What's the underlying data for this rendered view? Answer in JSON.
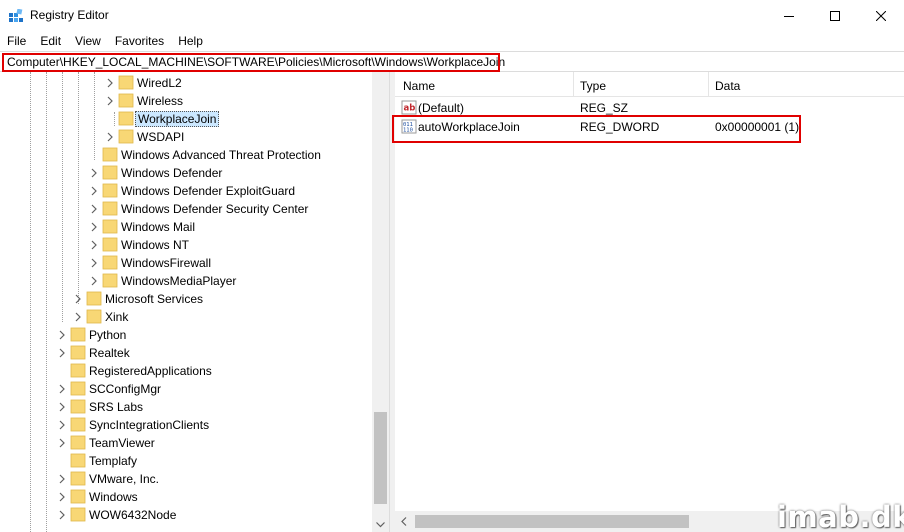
{
  "window": {
    "title": "Registry Editor",
    "minimize_icon": "minimize-icon",
    "maximize_icon": "maximize-icon",
    "close_icon": "close-icon"
  },
  "menu": [
    "File",
    "Edit",
    "View",
    "Favorites",
    "Help"
  ],
  "address": {
    "path": "Computer\\HKEY_LOCAL_MACHINE\\SOFTWARE\\Policies\\Microsoft\\Windows\\WorkplaceJoin",
    "highlight_color": "#e00000"
  },
  "tree": {
    "items": [
      {
        "label": "WiredL2",
        "expandable": true,
        "selected": false
      },
      {
        "label": "Wireless",
        "expandable": true,
        "selected": false
      },
      {
        "label": "WorkplaceJoin",
        "expandable": false,
        "selected": true
      },
      {
        "label": "WSDAPI",
        "expandable": true,
        "selected": false
      },
      {
        "label": "Windows Advanced Threat Protection",
        "expandable": false,
        "selected": false
      },
      {
        "label": "Windows Defender",
        "expandable": true,
        "selected": false
      },
      {
        "label": "Windows Defender ExploitGuard",
        "expandable": true,
        "selected": false
      },
      {
        "label": "Windows Defender Security Center",
        "expandable": true,
        "selected": false
      },
      {
        "label": "Windows Mail",
        "expandable": true,
        "selected": false
      },
      {
        "label": "Windows NT",
        "expandable": true,
        "selected": false
      },
      {
        "label": "WindowsFirewall",
        "expandable": true,
        "selected": false
      },
      {
        "label": "WindowsMediaPlayer",
        "expandable": true,
        "selected": false
      },
      {
        "label": "Microsoft Services",
        "expandable": true,
        "selected": false
      },
      {
        "label": "Xink",
        "expandable": true,
        "selected": false
      },
      {
        "label": "Python",
        "expandable": true,
        "selected": false
      },
      {
        "label": "Realtek",
        "expandable": true,
        "selected": false
      },
      {
        "label": "RegisteredApplications",
        "expandable": false,
        "selected": false
      },
      {
        "label": "SCConfigMgr",
        "expandable": true,
        "selected": false
      },
      {
        "label": "SRS Labs",
        "expandable": true,
        "selected": false
      },
      {
        "label": "SyncIntegrationClients",
        "expandable": true,
        "selected": false
      },
      {
        "label": "TeamViewer",
        "expandable": true,
        "selected": false
      },
      {
        "label": "Templafy",
        "expandable": false,
        "selected": false
      },
      {
        "label": "VMware, Inc.",
        "expandable": true,
        "selected": false
      },
      {
        "label": "Windows",
        "expandable": true,
        "selected": false
      },
      {
        "label": "WOW6432Node",
        "expandable": true,
        "selected": false
      }
    ],
    "selection_color": "#cce8ff",
    "folder_color": "#f8d775"
  },
  "list": {
    "columns": [
      "Name",
      "Type",
      "Data"
    ],
    "rows": [
      {
        "name": "(Default)",
        "type": "REG_SZ",
        "data": "",
        "icon": "string-value-icon"
      },
      {
        "name": "autoWorkplaceJoin",
        "type": "REG_DWORD",
        "data": "0x00000001 (1)",
        "icon": "dword-value-icon"
      }
    ]
  },
  "watermark": "imab.dk"
}
